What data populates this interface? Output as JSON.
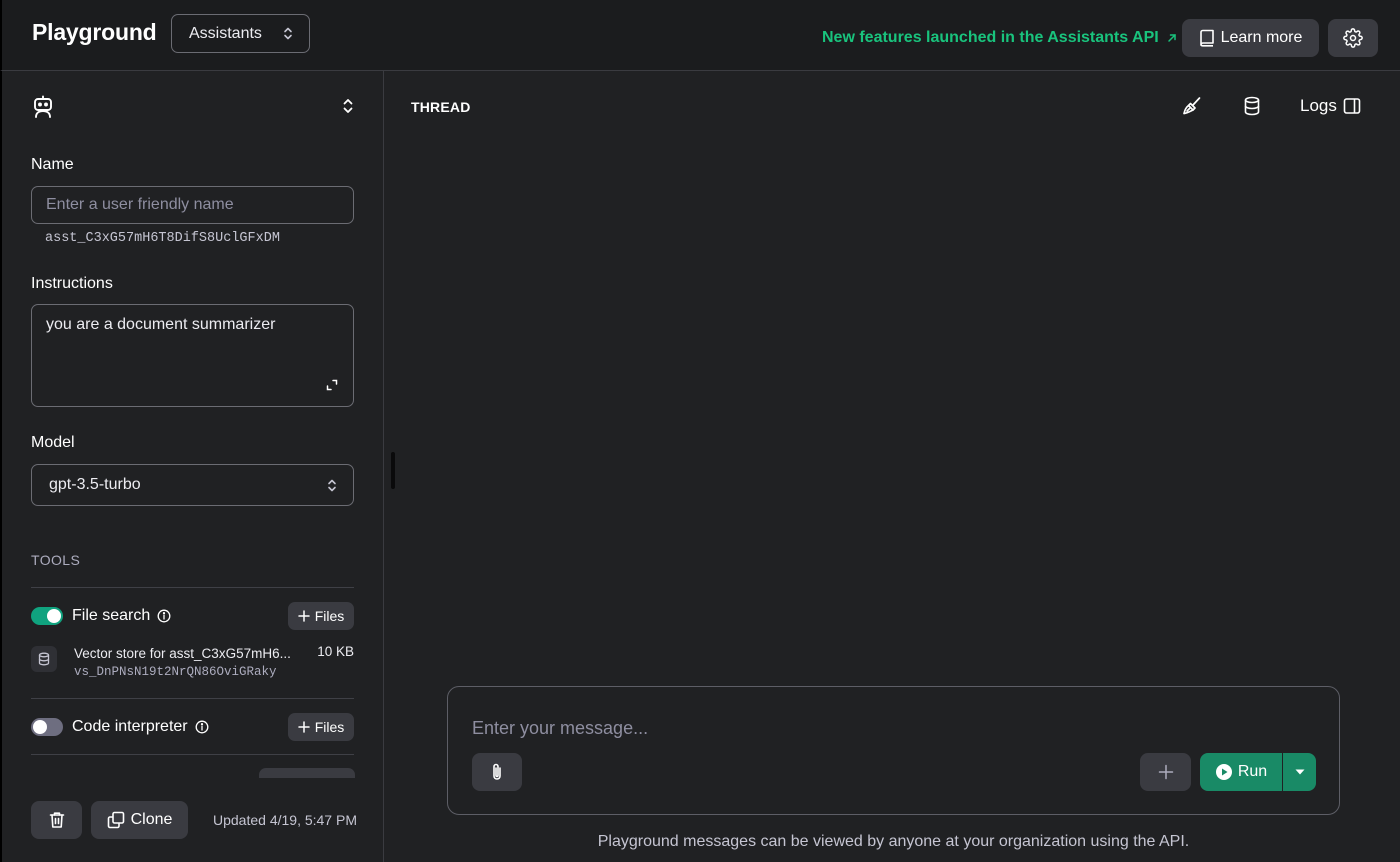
{
  "header": {
    "title": "Playground",
    "mode_select": "Assistants",
    "announcement": "New features launched in the Assistants API",
    "learn_more": "Learn more"
  },
  "assistant": {
    "name_label": "Name",
    "name_placeholder": "Enter a user friendly name",
    "id": "asst_C3xG57mH6T8DifS8UclGFxDM",
    "instructions_label": "Instructions",
    "instructions_value": "you are a document summarizer",
    "model_label": "Model",
    "model_value": "gpt-3.5-turbo"
  },
  "tools": {
    "heading": "TOOLS",
    "file_search": {
      "label": "File search",
      "enabled": true,
      "files_button": "Files",
      "vector_store": {
        "name": "Vector store for asst_C3xG57mH6...",
        "id": "vs_DnPNsN19t2NrQN86OviGRaky",
        "size": "10 KB"
      }
    },
    "code_interpreter": {
      "label": "Code interpreter",
      "enabled": false,
      "files_button": "Files"
    }
  },
  "footer": {
    "clone_label": "Clone",
    "updated": "Updated 4/19, 5:47 PM"
  },
  "thread": {
    "title": "THREAD",
    "logs_label": "Logs",
    "message_placeholder": "Enter your message...",
    "run_label": "Run",
    "disclaimer": "Playground messages can be viewed by anyone at your organization using the API."
  },
  "colors": {
    "accent": "#10a37f",
    "run_button": "#198a66",
    "link": "#19c37d",
    "background": "#202123"
  },
  "icons": {
    "assistant": "robot-icon",
    "mode_select": "chevron-up-down-icon",
    "announcement": "arrow-up-right-icon",
    "learn_more": "book-icon",
    "settings": "gear-icon",
    "expand": "expand-icon",
    "info": "info-icon",
    "vector_store": "database-icon",
    "delete": "trash-icon",
    "clone": "copy-icon",
    "thread_clear": "broom-icon",
    "thread_db": "database-icon",
    "logs": "sidebar-panel-icon",
    "attach": "paperclip-icon",
    "add_message": "plus-icon",
    "run": "play-circle-icon",
    "run_options": "caret-down-icon"
  }
}
